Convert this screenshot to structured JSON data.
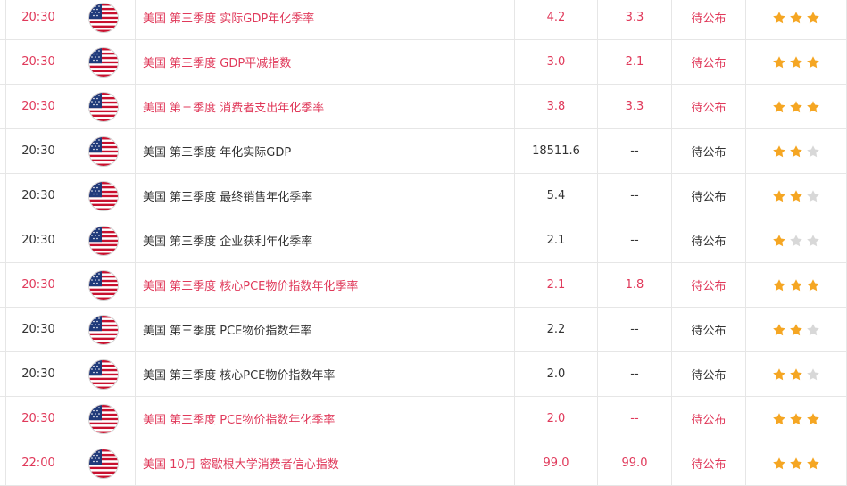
{
  "colors": {
    "highlight_text": "#e0395a",
    "normal_text": "#333333",
    "star_on": "#f5a623",
    "star_off": "#d8d8d8",
    "border": "#e6e6e6"
  },
  "rows": [
    {
      "time": "20:30",
      "event": "美国 第三季度 实际GDP年化季率",
      "previous": "4.2",
      "forecast": "3.3",
      "actual": "待公布",
      "importance": 3,
      "highlight": true,
      "flag_icon": "us-flag-icon"
    },
    {
      "time": "20:30",
      "event": "美国 第三季度 GDP平减指数",
      "previous": "3.0",
      "forecast": "2.1",
      "actual": "待公布",
      "importance": 3,
      "highlight": true,
      "flag_icon": "us-flag-icon"
    },
    {
      "time": "20:30",
      "event": "美国 第三季度 消费者支出年化季率",
      "previous": "3.8",
      "forecast": "3.3",
      "actual": "待公布",
      "importance": 3,
      "highlight": true,
      "flag_icon": "us-flag-icon"
    },
    {
      "time": "20:30",
      "event": "美国 第三季度 年化实际GDP",
      "previous": "18511.6",
      "forecast": "--",
      "actual": "待公布",
      "importance": 2,
      "highlight": false,
      "flag_icon": "us-flag-icon"
    },
    {
      "time": "20:30",
      "event": "美国 第三季度 最终销售年化季率",
      "previous": "5.4",
      "forecast": "--",
      "actual": "待公布",
      "importance": 2,
      "highlight": false,
      "flag_icon": "us-flag-icon"
    },
    {
      "time": "20:30",
      "event": "美国 第三季度 企业获利年化季率",
      "previous": "2.1",
      "forecast": "--",
      "actual": "待公布",
      "importance": 1,
      "highlight": false,
      "flag_icon": "us-flag-icon"
    },
    {
      "time": "20:30",
      "event": "美国 第三季度 核心PCE物价指数年化季率",
      "previous": "2.1",
      "forecast": "1.8",
      "actual": "待公布",
      "importance": 3,
      "highlight": true,
      "flag_icon": "us-flag-icon"
    },
    {
      "time": "20:30",
      "event": "美国 第三季度 PCE物价指数年率",
      "previous": "2.2",
      "forecast": "--",
      "actual": "待公布",
      "importance": 2,
      "highlight": false,
      "flag_icon": "us-flag-icon"
    },
    {
      "time": "20:30",
      "event": "美国 第三季度 核心PCE物价指数年率",
      "previous": "2.0",
      "forecast": "--",
      "actual": "待公布",
      "importance": 2,
      "highlight": false,
      "flag_icon": "us-flag-icon"
    },
    {
      "time": "20:30",
      "event": "美国 第三季度 PCE物价指数年化季率",
      "previous": "2.0",
      "forecast": "--",
      "actual": "待公布",
      "importance": 3,
      "highlight": true,
      "flag_icon": "us-flag-icon"
    },
    {
      "time": "22:00",
      "event": "美国 10月 密歇根大学消费者信心指数",
      "previous": "99.0",
      "forecast": "99.0",
      "actual": "待公布",
      "importance": 3,
      "highlight": true,
      "flag_icon": "us-flag-icon"
    }
  ]
}
